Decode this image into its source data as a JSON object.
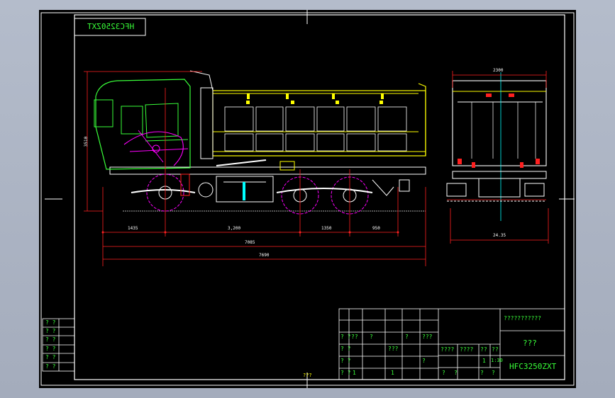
{
  "drawing": {
    "mirrored_title": "HFC3250ZXT",
    "title_block": {
      "company": "???????????",
      "drawing_name": "???",
      "drawing_code": "HFC3250ZXT",
      "scale_row": {
        "a": "????",
        "b": "????",
        "c": "??",
        "d": "??"
      },
      "sheet": "1",
      "scale": "1:30",
      "sign_row": {
        "a": "?",
        "b": "?",
        "c": "?",
        "d": "?"
      },
      "row_marks": [
        "? ?",
        "? ?",
        "? ?",
        "? ?"
      ],
      "cell_marks": [
        "??",
        "?",
        "???",
        "???"
      ],
      "small_marks": [
        "1",
        "1",
        "?",
        "?"
      ]
    },
    "revision_marks": [
      "? ?",
      "? ?",
      "? ?",
      "? ?",
      "? ?",
      "? ?"
    ],
    "center_mark": "???"
  },
  "dimensions": {
    "height": "3510",
    "overhang_front": "1435",
    "wheelbase_1": "3,200",
    "wheelbase_2": "1350",
    "overhang_rear": "950",
    "wheelbase_total": "7085",
    "overall_length": "7690",
    "rear_width_top": "2300",
    "rear_width_bottom": "24.35"
  },
  "colors": {
    "background": "#000000",
    "frame": "#ffffff",
    "dimension": "#ff2020",
    "body": "#ffff00",
    "cab": "#39ff39",
    "chassis": "#ffffff",
    "hydraulics": "#ff00ff",
    "axis": "#00ffff"
  }
}
